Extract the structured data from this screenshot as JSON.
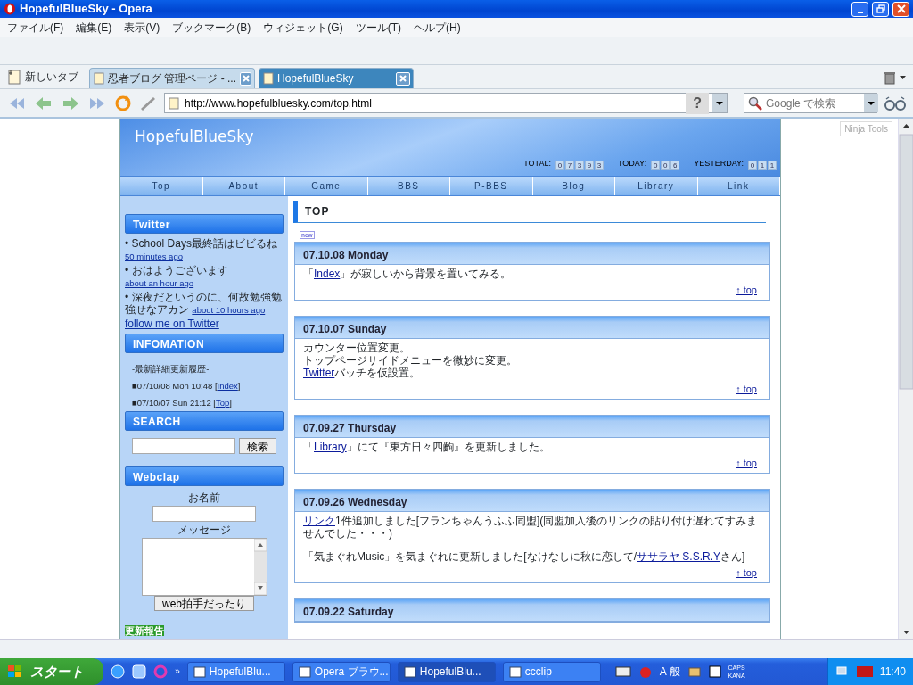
{
  "window": {
    "title": "HopefulBlueSky - Opera"
  },
  "menu": [
    "ファイル(F)",
    "編集(E)",
    "表示(V)",
    "ブックマーク(B)",
    "ウィジェット(G)",
    "ツール(T)",
    "ヘルプ(H)"
  ],
  "new_tab": {
    "label": "新しいタブ"
  },
  "tabs": [
    {
      "label": "忍者ブログ 管理ページ - ...",
      "selected": false
    },
    {
      "label": "HopefulBlueSky",
      "selected": true
    }
  ],
  "address": {
    "value": "http://www.hopefulbluesky.com/top.html",
    "help": "?"
  },
  "search": {
    "placeholder": "Google で検索"
  },
  "ninja_tools": "Ninja Tools",
  "site": {
    "title": "HopefulBlueSky",
    "counters": [
      {
        "label": "TOTAL:",
        "digits": [
          "0",
          "7",
          "3",
          "9",
          "3"
        ]
      },
      {
        "label": "TODAY:",
        "digits": [
          "0",
          "0",
          "6"
        ]
      },
      {
        "label": "YESTERDAY:",
        "digits": [
          "0",
          "1",
          "1"
        ]
      }
    ],
    "nav": [
      "Top",
      "About",
      "Game",
      "BBS",
      "P-BBS",
      "Blog",
      "Library",
      "Link"
    ]
  },
  "sidebar": {
    "twitter": {
      "heading": "Twitter",
      "items": [
        {
          "text": "•  School Days最終話はビビるね",
          "time": "50 minutes ago"
        },
        {
          "text": "•  おはようございます",
          "time": "about an hour ago"
        },
        {
          "text": "•  深夜だというのに、何故勉強勉強せなアカン",
          "time": "about 10 hours ago"
        }
      ],
      "follow": "follow me on Twitter"
    },
    "info": {
      "heading": "INFOMATION",
      "subheading": "-最新詳細更新履歴-",
      "items": [
        [
          {
            "t": "■07/10/08 Mon 10:48 [",
            "link": false
          },
          {
            "t": "Index",
            "link": true
          },
          {
            "t": "]",
            "link": false
          }
        ],
        [
          {
            "t": "■07/10/07 Sun 21:12 [",
            "link": false
          },
          {
            "t": "Top",
            "link": true
          },
          {
            "t": "]",
            "link": false
          }
        ]
      ]
    },
    "search": {
      "heading": "SEARCH",
      "button": "検索"
    },
    "webclap": {
      "heading": "Webclap",
      "name_label": "お名前",
      "message_label": "メッセージ",
      "button": "web拍手だったり"
    },
    "update_note": "更新報告"
  },
  "main": {
    "heading": "TOP",
    "badge": "new",
    "entries": [
      {
        "date": "07.10.08  Monday",
        "spaced": false,
        "lines": [
          [
            {
              "t": "「",
              "link": false
            },
            {
              "t": "Index",
              "link": true
            },
            {
              "t": "」が寂しいから背景を置いてみる。",
              "link": false
            }
          ]
        ],
        "top": "↑ top"
      },
      {
        "date": "07.10.07  Sunday",
        "spaced": false,
        "lines": [
          [
            {
              "t": "カウンター位置変更。",
              "link": false
            }
          ],
          [
            {
              "t": "トップページサイドメニューを微妙に変更。",
              "link": false
            }
          ],
          [
            {
              "t": "Twitter",
              "link": true
            },
            {
              "t": "バッチを仮設置。",
              "link": false
            }
          ]
        ],
        "top": "↑ top"
      },
      {
        "date": "07.09.27  Thursday",
        "spaced": false,
        "lines": [
          [
            {
              "t": "「",
              "link": false
            },
            {
              "t": "Library",
              "link": true
            },
            {
              "t": "」にて『東方日々四齣』を更新しました。",
              "link": false
            }
          ]
        ],
        "top": "↑ top"
      },
      {
        "date": "07.09.26  Wednesday",
        "spaced": true,
        "lines": [
          [
            {
              "t": "リンク",
              "link": true
            },
            {
              "t": "1件追加しました[フランちゃんうふふ同盟](同盟加入後のリンクの貼り付け遅れてすみませんでした・・・)",
              "link": false
            }
          ],
          [
            {
              "t": "「気まぐれMusic」を気まぐれに更新しました[なけなしに秋に恋して/",
              "link": false
            },
            {
              "t": "ササラヤ S.S.R.Y",
              "link": true
            },
            {
              "t": "さん]",
              "link": false
            }
          ]
        ],
        "top": "↑ top"
      },
      {
        "date": "07.09.22  Saturday"
      }
    ]
  },
  "taskbar": {
    "start": "スタート",
    "more": "»",
    "tasks": [
      {
        "label": "HopefulBlu...",
        "selected": false
      },
      {
        "label": "Opera ブラウ...",
        "selected": false
      },
      {
        "label": "HopefulBlu...",
        "selected": true
      },
      {
        "label": "ccclip",
        "selected": false
      }
    ],
    "ime": "A 般",
    "caps": "CAPS",
    "kana": "KANA",
    "clock": "11:40"
  }
}
